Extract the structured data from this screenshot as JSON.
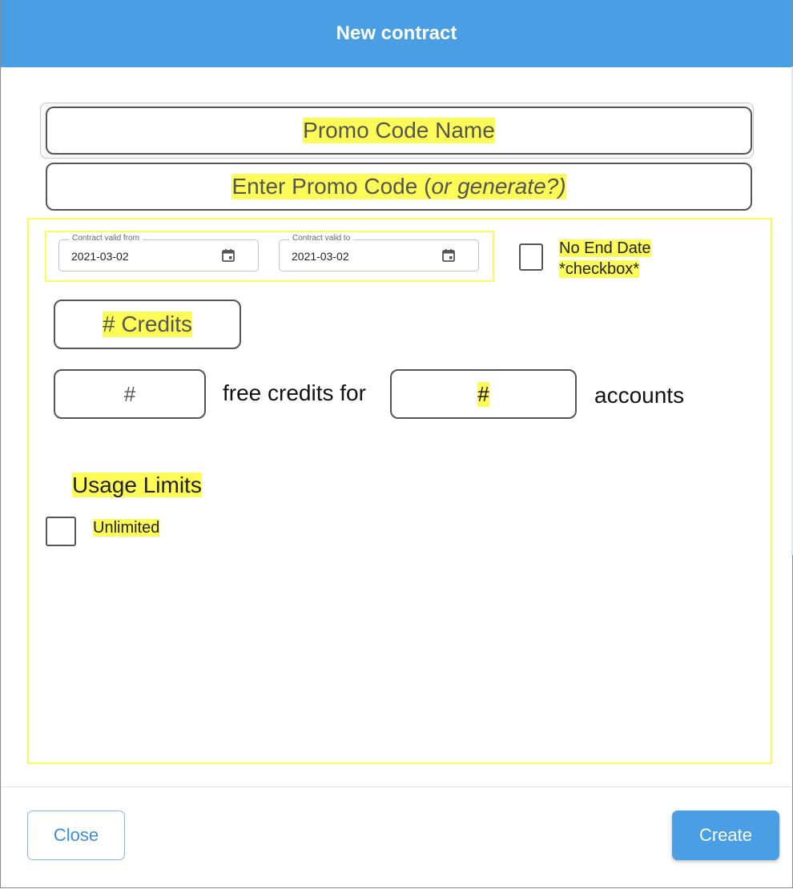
{
  "dialog": {
    "title": "New contract"
  },
  "promo": {
    "name_placeholder": "Promo Code Name",
    "code_placeholder_main": "Enter Promo Code (",
    "code_placeholder_italic": "or generate?)"
  },
  "dates": {
    "from_label": "Contract valid from",
    "from_value": "2021-03-02",
    "to_label": "Contract valid to",
    "to_value": "2021-03-02",
    "no_end_line1": "No End Date",
    "no_end_line2": "*checkbox*"
  },
  "credits": {
    "credits_placeholder": "# Credits",
    "free_count_placeholder": "#",
    "free_text": "free credits for",
    "accounts_placeholder": "#",
    "accounts_text": "accounts"
  },
  "usage": {
    "heading": "Usage Limits",
    "unlimited_label": "Unlimited"
  },
  "footer": {
    "close_label": "Close",
    "create_label": "Create"
  },
  "colors": {
    "header": "#4a9ee3",
    "highlight": "#fdfb57",
    "primary": "#4a9ee3"
  }
}
